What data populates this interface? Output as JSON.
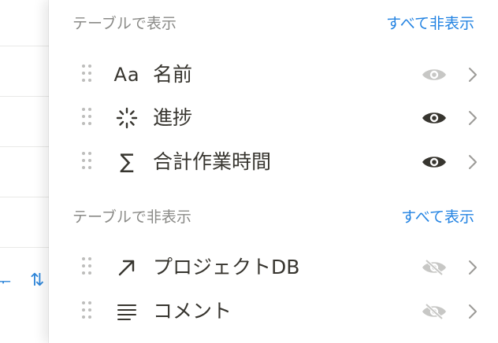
{
  "shown_section": {
    "title": "テーブルで表示",
    "action": "すべて非表示"
  },
  "hidden_section": {
    "title": "テーブルで非表示",
    "action": "すべて表示"
  },
  "shown_properties": [
    {
      "icon": "text-icon",
      "icon_text": "Aa",
      "label": "名前",
      "visibility": "visible-muted"
    },
    {
      "icon": "status-spinner-icon",
      "label": "進捗",
      "visibility": "visible"
    },
    {
      "icon": "sigma-icon",
      "icon_text": "∑",
      "label": "合計作業時間",
      "visibility": "visible"
    }
  ],
  "hidden_properties": [
    {
      "icon": "relation-arrow-icon",
      "label": "プロジェクトDB",
      "visibility": "hidden"
    },
    {
      "icon": "text-lines-icon",
      "label": "コメント",
      "visibility": "hidden"
    }
  ],
  "background": {
    "sort_icon_text": "⇅"
  },
  "colors": {
    "accent": "#2383e2",
    "text": "#37352f",
    "muted": "#8a8a87",
    "eye_muted": "#c7c7c5"
  }
}
